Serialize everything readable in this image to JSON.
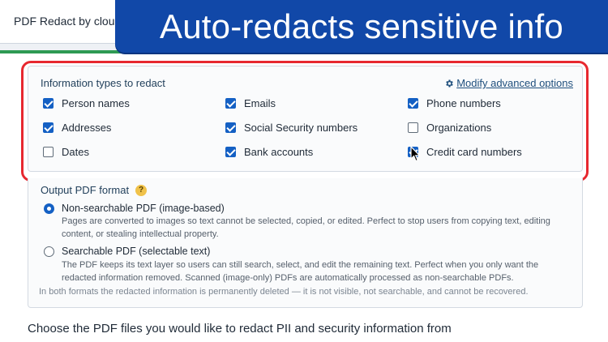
{
  "app_tab": {
    "label": "PDF Redact by cloud"
  },
  "banner": {
    "text": "Auto-redacts sensitive info"
  },
  "types": {
    "title": "Information types to redact",
    "advanced_link": "Modify advanced options",
    "items": [
      {
        "label": "Person names",
        "checked": true
      },
      {
        "label": "Emails",
        "checked": true
      },
      {
        "label": "Phone numbers",
        "checked": true
      },
      {
        "label": "Addresses",
        "checked": true
      },
      {
        "label": "Social Security numbers",
        "checked": true
      },
      {
        "label": "Organizations",
        "checked": false
      },
      {
        "label": "Dates",
        "checked": false
      },
      {
        "label": "Bank accounts",
        "checked": true
      },
      {
        "label": "Credit card numbers",
        "checked": true
      }
    ]
  },
  "output": {
    "title": "Output PDF format",
    "help": "?",
    "options": [
      {
        "label": "Non-searchable PDF (image-based)",
        "selected": true,
        "desc_line1": "Pages are converted to images so text cannot be selected, copied, or edited. Perfect to stop users from copying text, editing",
        "desc_line2": "content, or stealing intellectual property."
      },
      {
        "label": "Searchable PDF (selectable text)",
        "selected": false,
        "desc_line1": "The PDF keeps its text layer so users can still search, select, and edit the remaining text. Perfect when you only want the",
        "desc_line2": "redacted information removed. Scanned (image-only) PDFs are automatically processed as non-searchable PDFs."
      }
    ],
    "note": "In both formats the redacted information is permanently deleted — it is not visible, not searchable, and cannot be recovered."
  },
  "bottom": {
    "text": "Choose the PDF files you would like to redact PII and security information from"
  },
  "colors": {
    "accent": "#1460c4",
    "banner": "#1148a8",
    "highlight": "#e7282f",
    "brand_green": "#2e9a53"
  }
}
